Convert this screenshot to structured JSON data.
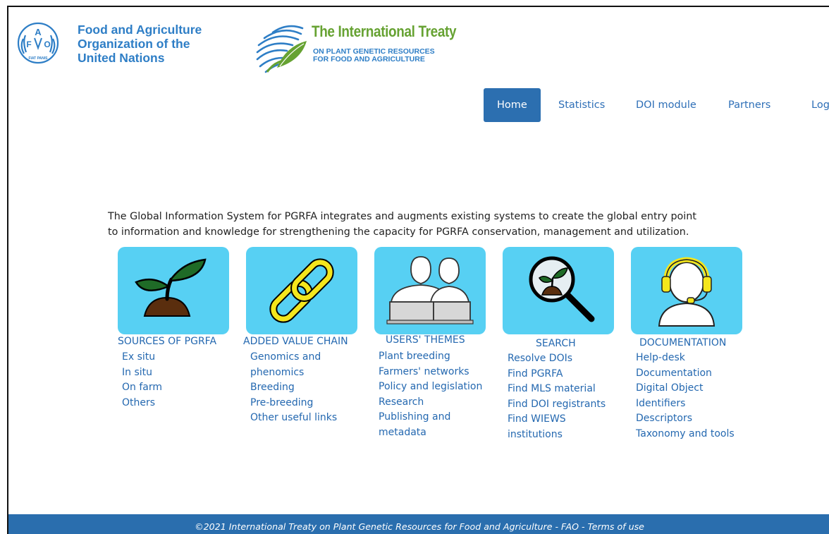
{
  "header": {
    "fao_lines": [
      "Food and Agriculture",
      "Organization of the",
      "United Nations"
    ],
    "fao_emblem_letters": [
      "F",
      "A",
      "O",
      "FIAT PANIS"
    ],
    "treaty_title": "The International Treaty",
    "treaty_subtitle_lines": [
      "ON PLANT GENETIC RESOURCES",
      "FOR FOOD AND AGRICULTURE"
    ]
  },
  "nav": {
    "items": [
      {
        "label": "Home",
        "active": true
      },
      {
        "label": "Statistics"
      },
      {
        "label": "DOI module"
      },
      {
        "label": "Partners"
      },
      {
        "label": "Login"
      }
    ]
  },
  "intro": {
    "line1": "The Global Information System for PGRFA integrates and augments existing systems to create the global entry point",
    "line2": "to information and knowledge for strengthening the capacity for PGRFA conservation, management and utilization."
  },
  "columns": [
    {
      "title": "SOURCES OF PGRFA",
      "icon": "sprout-icon",
      "links": [
        "Ex situ",
        "In situ",
        "On farm",
        "Others"
      ]
    },
    {
      "title": "ADDED VALUE CHAIN",
      "icon": "chain-link-icon",
      "links": [
        "Genomics and",
        "phenomics",
        "Breeding",
        "Pre-breeding",
        "Other useful links"
      ]
    },
    {
      "title": "USERS' THEMES",
      "icon": "users-icon",
      "links": [
        "Plant breeding",
        "Farmers' networks",
        "Policy and legislation",
        "Research",
        "Publishing and",
        "metadata"
      ]
    },
    {
      "title": "SEARCH",
      "icon": "magnifier-plant-icon",
      "links": [
        "Resolve DOIs",
        "Find PGRFA",
        "Find MLS material",
        "Find DOI registrants",
        "Find WIEWS",
        "institutions"
      ]
    },
    {
      "title": "DOCUMENTATION",
      "icon": "helpdesk-headset-icon",
      "links": [
        "Help-desk",
        "Documentation",
        "Digital Object",
        "Identifiers",
        "Descriptors",
        "Taxonomy and tools"
      ]
    }
  ],
  "footer": {
    "text": "©2021 International Treaty on Plant Genetic Resources for Food and Agriculture - FAO - Terms of use"
  },
  "colors": {
    "accent": "#2c6fb0",
    "tile": "#57d0f3",
    "link": "#2468b0",
    "treaty_green": "#66a232"
  }
}
